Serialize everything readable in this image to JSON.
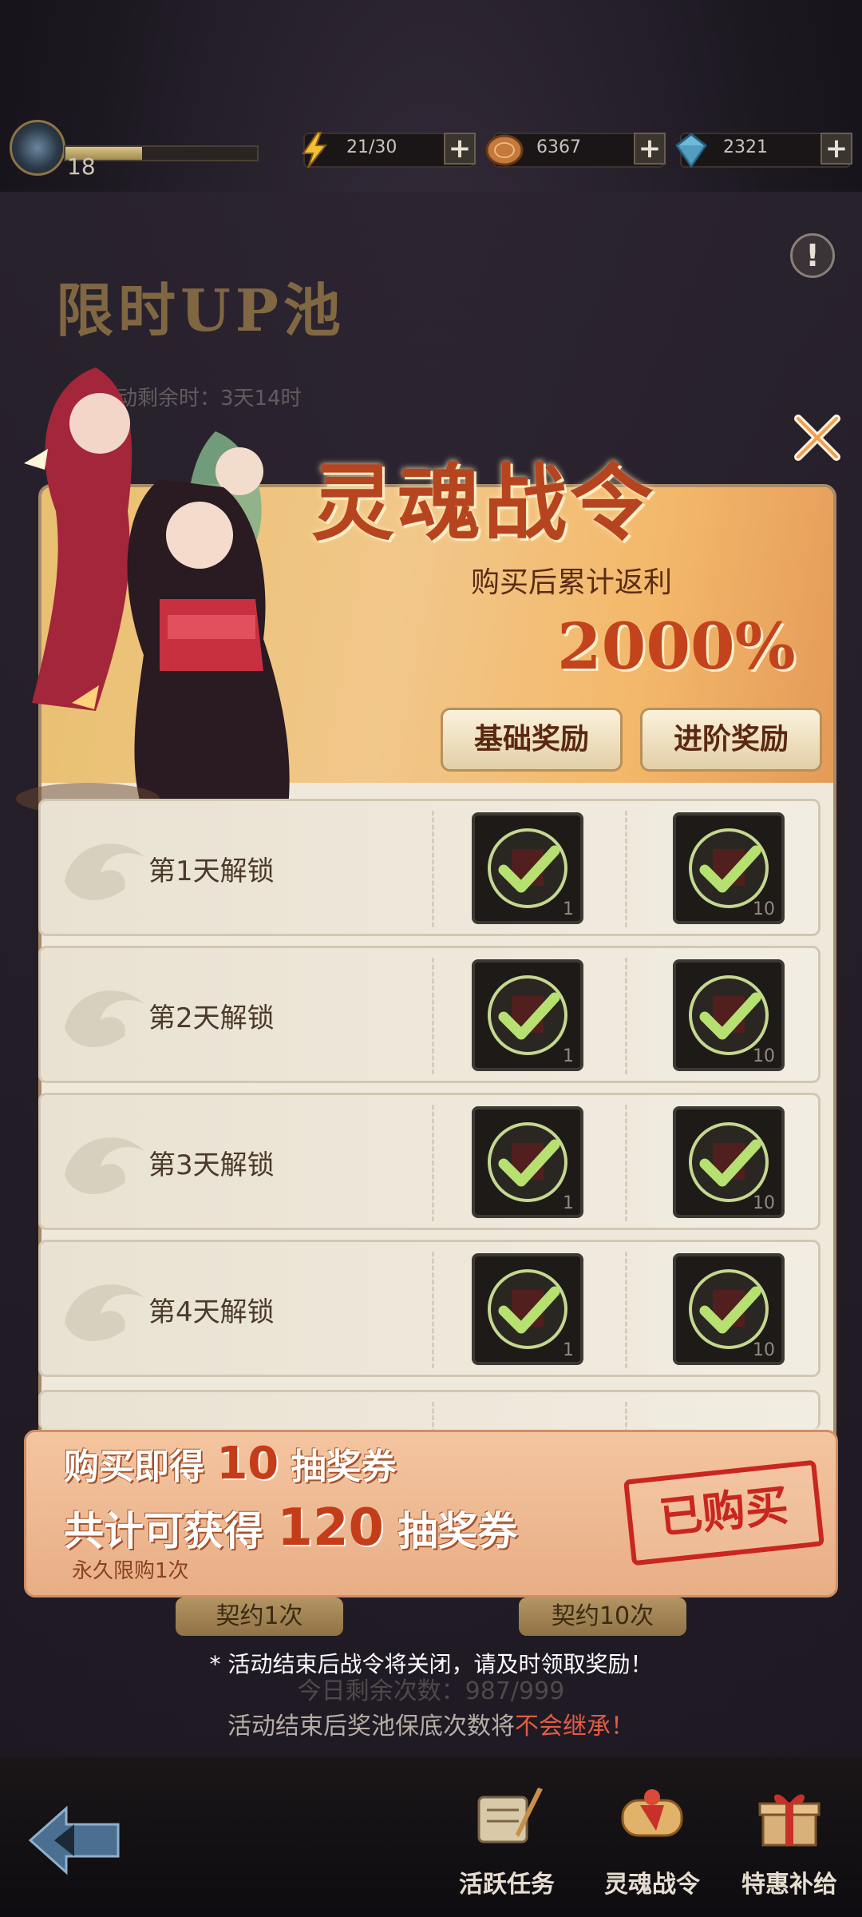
{
  "topbar": {
    "level": "18",
    "xp_progress": 0.4,
    "energy": "21/30",
    "coins": "6367",
    "gems": "2321"
  },
  "background": {
    "title": "限时UP池",
    "subtitle": "活动剩余时：3天14时",
    "button_1": "契约1次",
    "button_10": "契约10次",
    "remaining": "今日剩余次数：987/999",
    "warn_prefix": "活动结束后奖池保底次数将",
    "warn_highlight": "不会继承！"
  },
  "notice": "* 活动结束后战令将关闭，请及时领取奖励！",
  "modal": {
    "title": "灵魂战令",
    "subtitle": "购买后累计返利",
    "percent": "2000%",
    "tab_basic": "基础奖励",
    "tab_advanced": "进阶奖励",
    "rows": [
      {
        "label": "第1天解锁",
        "basic_qty": "1",
        "adv_qty": "10"
      },
      {
        "label": "第2天解锁",
        "basic_qty": "1",
        "adv_qty": "10"
      },
      {
        "label": "第3天解锁",
        "basic_qty": "1",
        "adv_qty": "10"
      },
      {
        "label": "第4天解锁",
        "basic_qty": "1",
        "adv_qty": "10"
      }
    ],
    "buy": {
      "line1_prefix": "购买即得",
      "line1_num": "10",
      "line1_suffix": "抽奖券",
      "line2_prefix": "共计可获得",
      "line2_num": "120",
      "line2_suffix": "抽奖券",
      "limit": "永久限购1次",
      "stamp": "已购买"
    }
  },
  "nav": {
    "item1": "活跃任务",
    "item2": "灵魂战令",
    "item3": "特惠补给"
  },
  "colors": {
    "accent": "#c43d18",
    "check": "#b6e070",
    "stamp": "#c8261e"
  }
}
